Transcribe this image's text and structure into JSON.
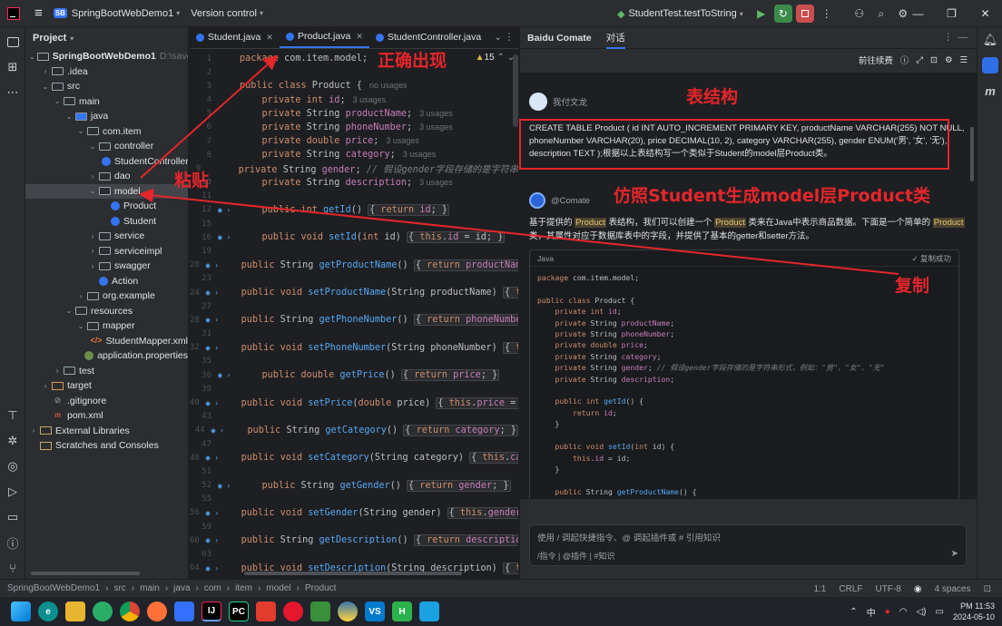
{
  "titlebar": {
    "project_badge": "SB",
    "project_name": "SpringBootWebDemo1",
    "vcs": "Version control",
    "run_config": "StudentTest.testToString"
  },
  "project_panel": {
    "title": "Project",
    "tree": [
      {
        "label": "SpringBootWebDemo1",
        "hint": "D:\\save\\stu",
        "depth": 0,
        "expanded": true,
        "icon": "module",
        "bold": true
      },
      {
        "label": ".idea",
        "depth": 1,
        "expanded": false,
        "icon": "folder"
      },
      {
        "label": "src",
        "depth": 1,
        "expanded": true,
        "icon": "folder"
      },
      {
        "label": "main",
        "depth": 2,
        "expanded": true,
        "icon": "folder"
      },
      {
        "label": "java",
        "depth": 3,
        "expanded": true,
        "icon": "javaf"
      },
      {
        "label": "com.item",
        "depth": 4,
        "expanded": true,
        "icon": "pkg"
      },
      {
        "label": "controller",
        "depth": 5,
        "expanded": true,
        "icon": "pkg"
      },
      {
        "label": "StudentController",
        "depth": 6,
        "icon": "cls"
      },
      {
        "label": "dao",
        "depth": 5,
        "expanded": false,
        "icon": "pkg"
      },
      {
        "label": "model",
        "depth": 5,
        "expanded": true,
        "icon": "pkg",
        "selected": true
      },
      {
        "label": "Product",
        "depth": 6,
        "icon": "cls"
      },
      {
        "label": "Student",
        "depth": 6,
        "icon": "cls"
      },
      {
        "label": "service",
        "depth": 5,
        "expanded": false,
        "icon": "pkg"
      },
      {
        "label": "serviceimpl",
        "depth": 5,
        "expanded": false,
        "icon": "pkg"
      },
      {
        "label": "swagger",
        "depth": 5,
        "expanded": false,
        "icon": "pkg"
      },
      {
        "label": "Action",
        "depth": 5,
        "icon": "cls"
      },
      {
        "label": "org.example",
        "depth": 4,
        "expanded": false,
        "icon": "pkg"
      },
      {
        "label": "resources",
        "depth": 3,
        "expanded": true,
        "icon": "folder"
      },
      {
        "label": "mapper",
        "depth": 4,
        "expanded": true,
        "icon": "folder"
      },
      {
        "label": "StudentMapper.xml",
        "depth": 5,
        "icon": "xml"
      },
      {
        "label": "application.properties",
        "depth": 4,
        "icon": "prop"
      },
      {
        "label": "test",
        "depth": 2,
        "expanded": false,
        "icon": "folder"
      },
      {
        "label": "target",
        "depth": 1,
        "expanded": false,
        "icon": "target"
      },
      {
        "label": ".gitignore",
        "depth": 1,
        "icon": "git"
      },
      {
        "label": "pom.xml",
        "depth": 1,
        "icon": "mvn"
      },
      {
        "label": "External Libraries",
        "depth": 0,
        "expanded": false,
        "icon": "lib"
      },
      {
        "label": "Scratches and Consoles",
        "depth": 0,
        "icon": "scratch"
      }
    ]
  },
  "editor": {
    "tabs": [
      {
        "label": "Student.java",
        "active": false
      },
      {
        "label": "Product.java",
        "active": true
      },
      {
        "label": "StudentController.java",
        "active": false
      }
    ],
    "warnings": "15",
    "lines": [
      {
        "n": "1",
        "html": "<span class=\"kw\">package</span> com.item.model;"
      },
      {
        "n": "2",
        "html": ""
      },
      {
        "n": "3",
        "html": "<span class=\"kw\">public class</span> Product {<span class=\"hint\">no usages</span>"
      },
      {
        "n": "4",
        "html": "    <span class=\"kw\">private int</span> <span class=\"fld\">id</span>;<span class=\"hint\">3 usages</span>"
      },
      {
        "n": "5",
        "html": "    <span class=\"kw\">private</span> String <span class=\"fld\">productName</span>;<span class=\"hint\">3 usages</span>"
      },
      {
        "n": "6",
        "html": "    <span class=\"kw\">private</span> String <span class=\"fld\">phoneNumber</span>;<span class=\"hint\">3 usages</span>"
      },
      {
        "n": "7",
        "html": "    <span class=\"kw\">private double</span> <span class=\"fld\">price</span>;<span class=\"hint\">3 usages</span>"
      },
      {
        "n": "8",
        "html": "    <span class=\"kw\">private</span> String <span class=\"fld\">category</span>;<span class=\"hint\">3 usages</span>"
      },
      {
        "n": "9",
        "html": "    <span class=\"kw\">private</span> String <span class=\"fld\">gender</span>; <span class=\"cm\">// 假设gender字段存储的是字符串</span>"
      },
      {
        "n": "10",
        "html": "    <span class=\"kw\">private</span> String <span class=\"fld\">description</span>;<span class=\"hint\">3 usages</span>"
      },
      {
        "n": "11",
        "html": ""
      },
      {
        "n": "12",
        "html": "    <span class=\"kw\">public int</span> <span class=\"fn\">getId</span>() <span class=\"fold\">{ <span class=\"kw\">return</span> <span class=\"fld\">id</span>; }</span>",
        "g": true
      },
      {
        "n": "15",
        "html": ""
      },
      {
        "n": "16",
        "html": "    <span class=\"kw\">public void</span> <span class=\"fn\">setId</span>(<span class=\"kw\">int</span> id) <span class=\"fold\">{ <span class=\"kw\">this</span>.<span class=\"fld\">id</span> = id; }</span>",
        "g": true
      },
      {
        "n": "19",
        "html": ""
      },
      {
        "n": "20",
        "html": "    <span class=\"kw\">public</span> String <span class=\"fn\">getProductName</span>() <span class=\"fold\">{ <span class=\"kw\">return</span> <span class=\"fld\">productName</span></span>",
        "g": true
      },
      {
        "n": "23",
        "html": ""
      },
      {
        "n": "24",
        "html": "    <span class=\"kw\">public void</span> <span class=\"fn\">setProductName</span>(String productName) <span class=\"fold\">{ <span class=\"kw\">th</span></span>",
        "g": true
      },
      {
        "n": "27",
        "html": ""
      },
      {
        "n": "28",
        "html": "    <span class=\"kw\">public</span> String <span class=\"fn\">getPhoneNumber</span>() <span class=\"fold\">{ <span class=\"kw\">return</span> <span class=\"fld\">phoneNumber</span></span>",
        "g": true
      },
      {
        "n": "31",
        "html": ""
      },
      {
        "n": "32",
        "html": "    <span class=\"kw\">public void</span> <span class=\"fn\">setPhoneNumber</span>(String phoneNumber) <span class=\"fold\">{ <span class=\"kw\">th</span></span>",
        "g": true
      },
      {
        "n": "35",
        "html": ""
      },
      {
        "n": "36",
        "html": "    <span class=\"kw\">public double</span> <span class=\"fn\">getPrice</span>() <span class=\"fold\">{ <span class=\"kw\">return</span> <span class=\"fld\">price</span>; }</span>",
        "g": true
      },
      {
        "n": "39",
        "html": ""
      },
      {
        "n": "40",
        "html": "    <span class=\"kw\">public void</span> <span class=\"fn\">setPrice</span>(<span class=\"kw\">double</span> price) <span class=\"fold\">{ <span class=\"kw\">this</span>.<span class=\"fld\">price</span> = p</span>",
        "g": true
      },
      {
        "n": "43",
        "html": ""
      },
      {
        "n": "44",
        "html": "    <span class=\"kw\">public</span> String <span class=\"fn\">getCategory</span>() <span class=\"fold\">{ <span class=\"kw\">return</span> <span class=\"fld\">category</span>; }</span>",
        "g": true
      },
      {
        "n": "47",
        "html": ""
      },
      {
        "n": "48",
        "html": "    <span class=\"kw\">public void</span> <span class=\"fn\">setCategory</span>(String category) <span class=\"fold\">{ <span class=\"kw\">this</span>.<span class=\"fld\">cate</span></span>",
        "g": true
      },
      {
        "n": "51",
        "html": ""
      },
      {
        "n": "52",
        "html": "    <span class=\"kw\">public</span> String <span class=\"fn\">getGender</span>() <span class=\"fold\">{ <span class=\"kw\">return</span> <span class=\"fld\">gender</span>; }</span>",
        "g": true
      },
      {
        "n": "55",
        "html": ""
      },
      {
        "n": "56",
        "html": "    <span class=\"kw\">public void</span> <span class=\"fn\">setGender</span>(String gender) <span class=\"fold\">{ <span class=\"kw\">this</span>.<span class=\"fld\">gender</span></span>",
        "g": true
      },
      {
        "n": "59",
        "html": ""
      },
      {
        "n": "60",
        "html": "    <span class=\"kw\">public</span> String <span class=\"fn\">getDescription</span>() <span class=\"fold\">{ <span class=\"kw\">return</span> <span class=\"fld\">description</span></span>",
        "g": true
      },
      {
        "n": "63",
        "html": ""
      },
      {
        "n": "64",
        "html": "    <span class=\"kw\">public void</span> <span class=\"fn\">setDescription</span>(String description) <span class=\"fold\">{ <span class=\"kw\">th</span></span>",
        "g": true
      }
    ]
  },
  "comate": {
    "title": "Baidu Comate",
    "tab": "对话",
    "toolbar_text": "前往续费",
    "user_name": "我付文龙",
    "user_message": "CREATE TABLE Product ( id INT AUTO_INCREMENT PRIMARY KEY, productName VARCHAR(255) NOT NULL, phoneNumber VARCHAR(20), price DECIMAL(10, 2), category VARCHAR(255), gender ENUM('男', '女', '无'), description TEXT );根据以上表结构写一个类似于Student的model层Product类。",
    "bot_name": "@Comate",
    "reply_html": "基于提供的 <span class=\"hl\">Product</span> 表结构，我们可以创建一个 <span class=\"hl\">Product</span> 类来在Java中表示商品数据。下面是一个简单的 <span class=\"hl\">Product</span> 类，其属性对应于数据库表中的字段，并提供了基本的getter和setter方法。",
    "code_lang": "Java",
    "copied": "复制成功",
    "code_html": "<span class=\"kw\">package</span> com.item.model;\n\n<span class=\"kw\">public class</span> Product {\n    <span class=\"kw\">private int</span> <span class=\"fld\">id</span>;\n    <span class=\"kw\">private</span> String <span class=\"fld\">productName</span>;\n    <span class=\"kw\">private</span> String <span class=\"fld\">phoneNumber</span>;\n    <span class=\"kw\">private double</span> <span class=\"fld\">price</span>;\n    <span class=\"kw\">private</span> String <span class=\"fld\">category</span>;\n    <span class=\"kw\">private</span> String <span class=\"fld\">gender</span>; <span class=\"cm\">// 假设gender字段存储的是字符串形式，例如：\"男\"、\"女\"、\"无\"</span>\n    <span class=\"kw\">private</span> String <span class=\"fld\">description</span>;\n\n    <span class=\"kw\">public int</span> <span class=\"fn\">getId</span>() {\n        <span class=\"kw\">return</span> <span class=\"fld\">id</span>;\n    }\n\n    <span class=\"kw\">public void</span> <span class=\"fn\">setId</span>(<span class=\"kw\">int</span> id) {\n        <span class=\"kw\">this</span>.<span class=\"fld\">id</span> = id;\n    }\n\n    <span class=\"kw\">public</span> String <span class=\"fn\">getProductName</span>() {\n        <span class=\"kw\">return</span> <span class=\"fld\">productName</span>;",
    "input_placeholder": "使用 / 调起快捷指令、@ 调起插件或 # 引用知识",
    "input_tools": "/指令  |  @插件  |  #知识"
  },
  "statusbar": {
    "breadcrumbs": [
      "SpringBootWebDemo1",
      "src",
      "main",
      "java",
      "com",
      "item",
      "model",
      "Product"
    ],
    "position": "1:1",
    "line_sep": "CRLF",
    "encoding": "UTF-8",
    "indent": "4 spaces"
  },
  "taskbar": {
    "ime": "中",
    "time": "PM 11:53",
    "date": "2024-05-10"
  },
  "annotations": {
    "a1": "正确出现",
    "a2": "粘贴",
    "a3": "表结构",
    "a4": "仿照Student生成model层Product类",
    "a5": "复制"
  },
  "colors": {
    "accent": "#3574f0",
    "annotation_red": "#e5262b",
    "editor_bg": "#1e1f22",
    "panel_bg": "#2b2d30"
  }
}
